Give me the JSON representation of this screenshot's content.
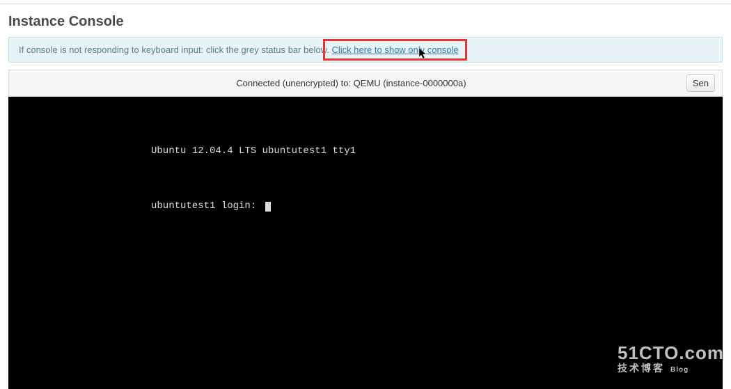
{
  "page": {
    "title": "Instance Console"
  },
  "banner": {
    "text_before": "If console is not responding to keyboard input: click the grey status bar below. ",
    "link_text": "Click here to show only console"
  },
  "status": {
    "text": "Connected (unencrypted) to: QEMU (instance-0000000a)",
    "button_label": "Sen"
  },
  "terminal": {
    "line1": "Ubuntu 12.04.4 LTS ubuntutest1 tty1",
    "line2": "ubuntutest1 login: "
  },
  "watermark": {
    "big": "51CTO.com",
    "small": "技术博客",
    "tag": "Blog"
  }
}
